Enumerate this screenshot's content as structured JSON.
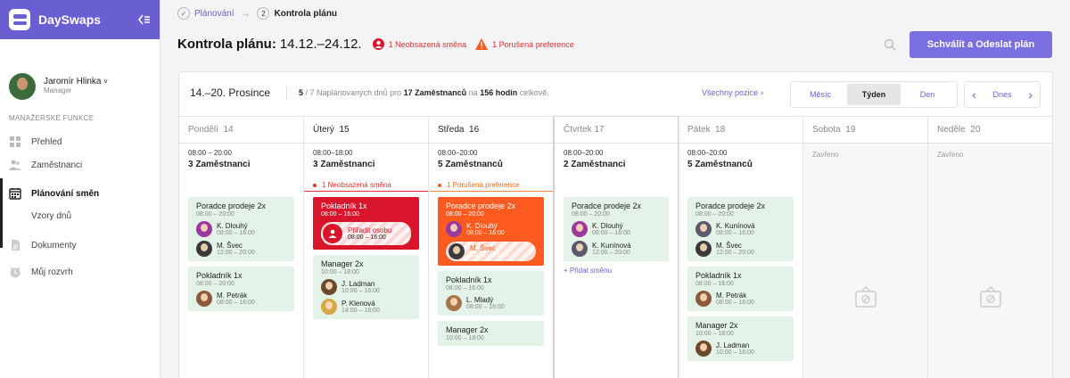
{
  "app": {
    "name": "DaySwaps",
    "collapse_icon": "collapse-icon"
  },
  "user": {
    "name": "Jaromír Hlinka",
    "role": "Manager",
    "chevron": "˅"
  },
  "sidebar": {
    "section": "MANAŽERSKÉ FUNKCE",
    "items": [
      {
        "label": "Přehled",
        "icon": "grid-icon"
      },
      {
        "label": "Zaměstnanci",
        "icon": "people-icon"
      },
      {
        "label": "Plánování směn",
        "icon": "calendar-icon",
        "active": true
      },
      {
        "label": "Vzory dnů",
        "sub": true
      },
      {
        "label": "Dokumenty",
        "icon": "document-icon"
      },
      {
        "label": "Můj rozvrh",
        "icon": "clock-icon"
      }
    ]
  },
  "breadcrumb": {
    "step1": "Plánování",
    "step2_num": "2",
    "step2": "Kontrola plánu",
    "arrow": "→"
  },
  "header": {
    "title_bold": "Kontrola plánu:",
    "title_range": "14.12.–24.12.",
    "alert1": "1 Neobsazená směna",
    "alert2": "1 Porušená preference",
    "approve": "Schválit a Odeslat plán"
  },
  "toolbar": {
    "range": "14.–20. Prosince",
    "summary": {
      "a": "5",
      "b": " / 7 Naplánovaných dnů ",
      "c": "pro",
      "d": "17",
      "e": "Zaměstnanců",
      "f": "na",
      "g": "156",
      "h": "hodin",
      "i": "celkově."
    },
    "positions": "Všechny pozice",
    "views": [
      "Měsíc",
      "Týden",
      "Den"
    ],
    "today": "Dnes",
    "prev": "‹",
    "next": "›"
  },
  "colors": {
    "accent": "#6a5fd0",
    "danger": "#d9152c",
    "warning": "#ff5a1f",
    "shift_bg": "#e3f3e7"
  },
  "days": [
    {
      "name": "Pondělí",
      "num": "14",
      "time": "08:00 – 20:00",
      "count": "3 Zaměstnanci"
    },
    {
      "name": "Úterý",
      "num": "15",
      "time": "08:00–18:00",
      "count": "3 Zaměstnanci",
      "warn": "1 Neobsazená směna"
    },
    {
      "name": "Středa",
      "num": "16",
      "time": "08:00–20:00",
      "count": "5 Zaměstnanců",
      "warn": "1 Porušená preference"
    },
    {
      "name": "Čtvrtek",
      "num": "17",
      "time": "08:00–20:00",
      "count": "2 Zaměstnanci",
      "add": "+ Přidat směnu"
    },
    {
      "name": "Pátek",
      "num": "18",
      "time": "08:00–20:00",
      "count": "5 Zaměstnanců"
    },
    {
      "name": "Sobota",
      "num": "19",
      "closed": "Zavřeno"
    },
    {
      "name": "Neděle",
      "num": "20",
      "closed": "Zavřeno"
    }
  ],
  "shifts": {
    "mon": [
      {
        "name": "Poradce prodeje 2x",
        "time": "08:00 – 20:00",
        "emps": [
          {
            "n": "K. Dlouhý",
            "t": "08:00 – 16:00"
          },
          {
            "n": "M. Švec",
            "t": "12:00 – 20:00"
          }
        ]
      },
      {
        "name": "Pokladník 1x",
        "time": "08:00 – 20:00",
        "emps": [
          {
            "n": "M. Petrák",
            "t": "08:00 – 16:00"
          }
        ]
      }
    ],
    "tue": [
      {
        "name": "Pokladník 1x",
        "time": "08:00 – 16:00",
        "assign": "Přiřadit osobu",
        "assign_time": "08:00 – 16:00"
      },
      {
        "name": "Manager 2x",
        "time": "10:00 – 18:00",
        "emps": [
          {
            "n": "J. Ladman",
            "t": "10:00 – 16:00"
          },
          {
            "n": "P. Klenová",
            "t": "14:00 – 18:00"
          }
        ]
      }
    ],
    "wed": [
      {
        "name": "Poradce prodeje 2x",
        "time": "08:00 – 20:00",
        "emps": [
          {
            "n": "K. Dlouhý",
            "t": "08:00 – 16:00"
          }
        ],
        "conflict": {
          "n": "M. Švec",
          "t": "12:00 – 20:00"
        }
      },
      {
        "name": "Pokladník 1x",
        "time": "08:00 – 16:00",
        "emps": [
          {
            "n": "L. Mladý",
            "t": "08:00 – 16:00"
          }
        ]
      },
      {
        "name": "Manager 2x",
        "time": "10:00 – 18:00"
      }
    ],
    "thu": [
      {
        "name": "Poradce prodeje 2x",
        "time": "08:00 – 20:00",
        "emps": [
          {
            "n": "K. Dlouhý",
            "t": "08:00 – 16:00"
          },
          {
            "n": "K. Kunínová",
            "t": "12:00 – 20:00"
          }
        ]
      }
    ],
    "fri": [
      {
        "name": "Poradce prodeje 2x",
        "time": "08:00 – 20:00",
        "emps": [
          {
            "n": "K. Kunínová",
            "t": "08:00 – 16:00"
          },
          {
            "n": "M. Švec",
            "t": "12:00 – 20:00"
          }
        ]
      },
      {
        "name": "Pokladník 1x",
        "time": "08:00 – 16:00",
        "emps": [
          {
            "n": "M. Petrák",
            "t": "08:00 – 16:00"
          }
        ]
      },
      {
        "name": "Manager 2x",
        "time": "10:00 – 18:00",
        "emps": [
          {
            "n": "J. Ladman",
            "t": "10:00 – 16:00"
          }
        ]
      }
    ]
  }
}
